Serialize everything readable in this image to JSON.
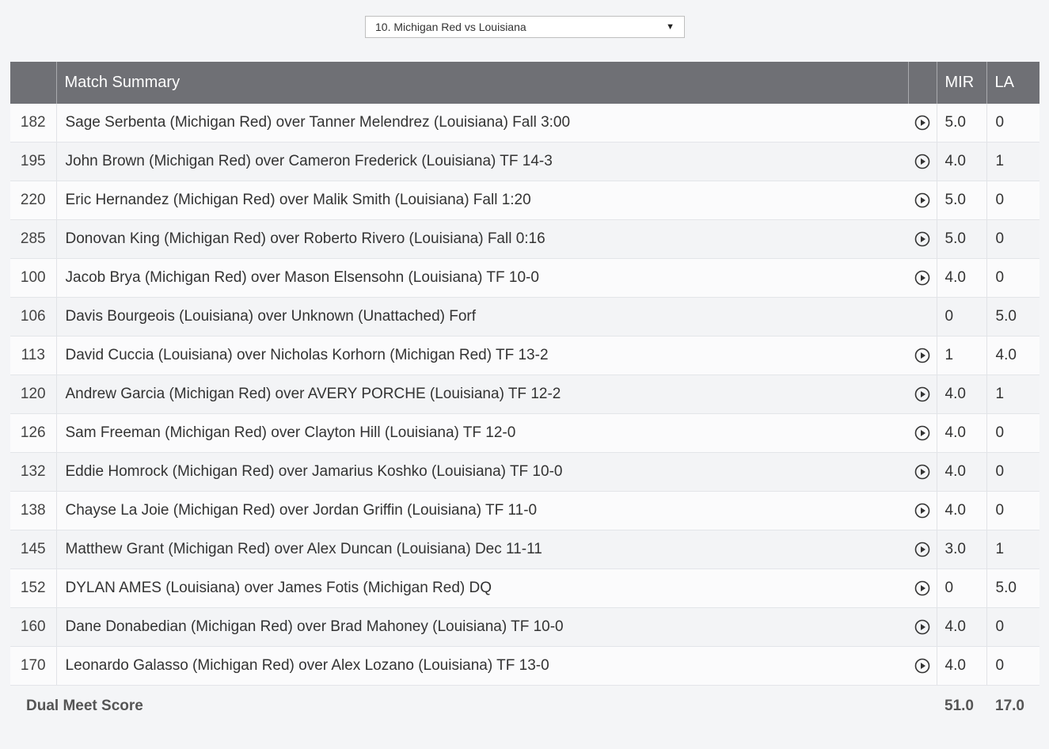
{
  "dual_select": {
    "selected": "10. Michigan Red vs Louisiana"
  },
  "header": {
    "weight": "",
    "match_summary": "Match Summary",
    "team1": "MIR",
    "team2": "LA"
  },
  "rows": [
    {
      "weight": "182",
      "summary": "Sage Serbenta (Michigan Red) over Tanner Melendrez (Louisiana) Fall 3:00",
      "has_video": true,
      "mir": "5.0",
      "la": "0"
    },
    {
      "weight": "195",
      "summary": "John Brown (Michigan Red) over Cameron Frederick (Louisiana) TF 14-3",
      "has_video": true,
      "mir": "4.0",
      "la": "1"
    },
    {
      "weight": "220",
      "summary": "Eric Hernandez (Michigan Red) over Malik Smith (Louisiana) Fall 1:20",
      "has_video": true,
      "mir": "5.0",
      "la": "0"
    },
    {
      "weight": "285",
      "summary": "Donovan King (Michigan Red) over Roberto Rivero (Louisiana) Fall 0:16",
      "has_video": true,
      "mir": "5.0",
      "la": "0"
    },
    {
      "weight": "100",
      "summary": "Jacob Brya (Michigan Red) over Mason Elsensohn (Louisiana) TF 10-0",
      "has_video": true,
      "mir": "4.0",
      "la": "0"
    },
    {
      "weight": "106",
      "summary": "Davis Bourgeois (Louisiana) over Unknown (Unattached) Forf",
      "has_video": false,
      "mir": "0",
      "la": "5.0"
    },
    {
      "weight": "113",
      "summary": "David Cuccia (Louisiana) over Nicholas Korhorn (Michigan Red) TF 13-2",
      "has_video": true,
      "mir": "1",
      "la": "4.0"
    },
    {
      "weight": "120",
      "summary": "Andrew Garcia (Michigan Red) over AVERY PORCHE (Louisiana) TF 12-2",
      "has_video": true,
      "mir": "4.0",
      "la": "1"
    },
    {
      "weight": "126",
      "summary": "Sam Freeman (Michigan Red) over Clayton Hill (Louisiana) TF 12-0",
      "has_video": true,
      "mir": "4.0",
      "la": "0"
    },
    {
      "weight": "132",
      "summary": "Eddie Homrock (Michigan Red) over Jamarius Koshko (Louisiana) TF 10-0",
      "has_video": true,
      "mir": "4.0",
      "la": "0"
    },
    {
      "weight": "138",
      "summary": "Chayse La Joie (Michigan Red) over Jordan Griffin (Louisiana) TF 11-0",
      "has_video": true,
      "mir": "4.0",
      "la": "0"
    },
    {
      "weight": "145",
      "summary": "Matthew Grant (Michigan Red) over Alex Duncan (Louisiana) Dec 11-11",
      "has_video": true,
      "mir": "3.0",
      "la": "1"
    },
    {
      "weight": "152",
      "summary": "DYLAN AMES (Louisiana) over James Fotis (Michigan Red) DQ",
      "has_video": true,
      "mir": "0",
      "la": "5.0"
    },
    {
      "weight": "160",
      "summary": "Dane Donabedian (Michigan Red) over Brad Mahoney (Louisiana) TF 10-0",
      "has_video": true,
      "mir": "4.0",
      "la": "0"
    },
    {
      "weight": "170",
      "summary": "Leonardo Galasso (Michigan Red) over Alex Lozano (Louisiana) TF 13-0",
      "has_video": true,
      "mir": "4.0",
      "la": "0"
    }
  ],
  "totals": {
    "label": "Dual Meet Score",
    "mir": "51.0",
    "la": "17.0"
  },
  "icons": {
    "video": "play-circle-icon",
    "dropdown": "dropdown-arrow-icon"
  },
  "colors": {
    "header_bg": "#6f7075",
    "header_text": "#ffffff"
  }
}
